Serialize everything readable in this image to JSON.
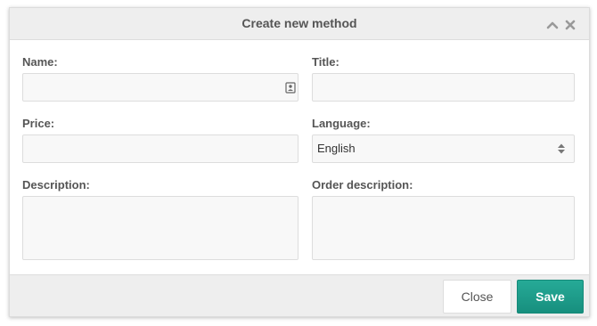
{
  "dialog": {
    "title": "Create new method",
    "collapse_icon": "chevron-up-icon",
    "close_icon": "close-icon"
  },
  "form": {
    "name_label": "Name:",
    "name_value": "",
    "name_icon": "contact-card-icon",
    "title_label": "Title:",
    "title_value": "",
    "price_label": "Price:",
    "price_value": "",
    "language_label": "Language:",
    "language_value": "English",
    "language_icon": "select-arrows-icon",
    "description_label": "Description:",
    "description_value": "",
    "order_description_label": "Order description:",
    "order_description_value": ""
  },
  "footer": {
    "close_label": "Close",
    "save_label": "Save"
  },
  "colors": {
    "header_bg": "#eeeeee",
    "footer_bg": "#eeeeee",
    "save_button": "#1fa08e",
    "input_bg": "#f8f8f8",
    "label_text": "#555555"
  }
}
